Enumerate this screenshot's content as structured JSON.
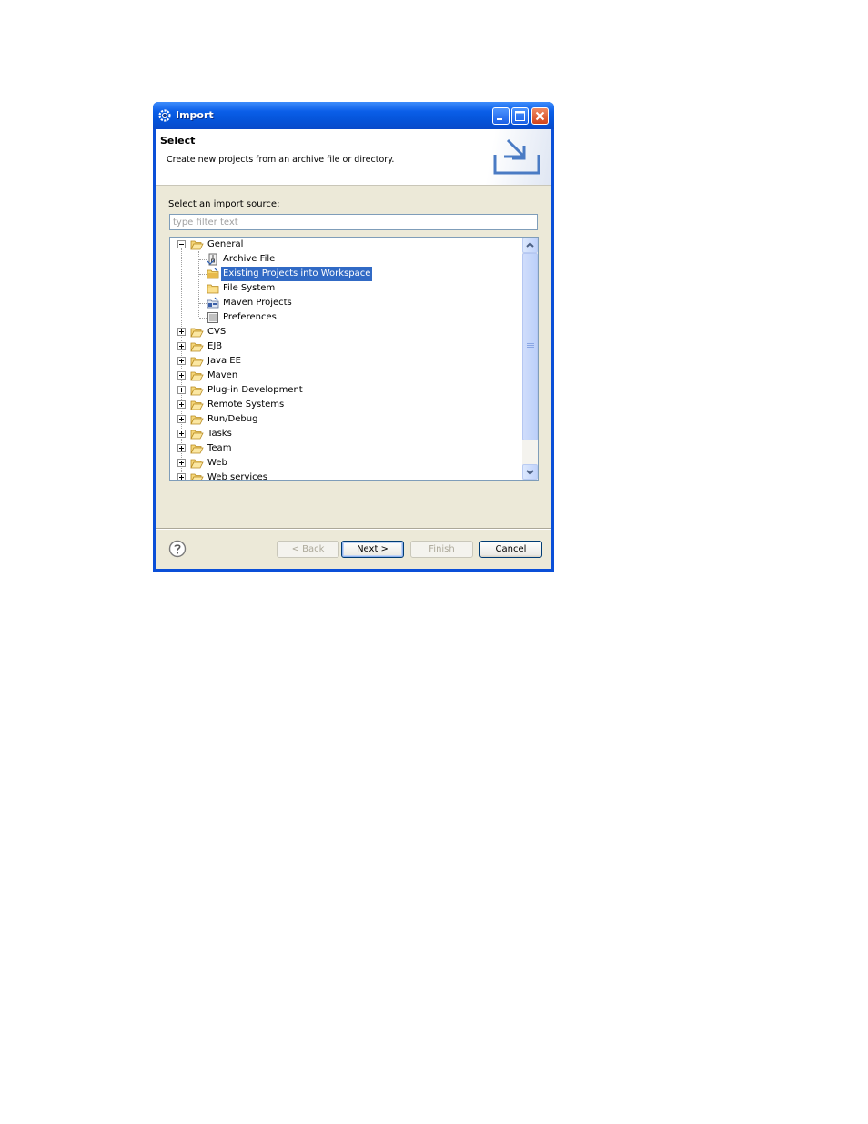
{
  "window": {
    "title": "Import",
    "icons": {
      "app": "eclipse-gear-icon",
      "minimize": "minimize-icon",
      "maximize": "maximize-icon",
      "close": "close-icon"
    }
  },
  "header": {
    "title": "Select",
    "description": "Create new projects from an archive file or directory.",
    "graphic": "import-wizard-icon"
  },
  "source": {
    "label": "Select an import source:",
    "filter_placeholder": "type filter text",
    "filter_value": ""
  },
  "tree": {
    "general": {
      "label": "General",
      "expanded": true,
      "children": [
        {
          "label": "Archive File",
          "icon": "archive-file-icon"
        },
        {
          "label": "Existing Projects into Workspace",
          "icon": "existing-projects-icon",
          "selected": true
        },
        {
          "label": "File System",
          "icon": "folder-icon"
        },
        {
          "label": "Maven Projects",
          "icon": "maven-projects-icon"
        },
        {
          "label": "Preferences",
          "icon": "preferences-icon"
        }
      ]
    },
    "categories": [
      "CVS",
      "EJB",
      "Java EE",
      "Maven",
      "Plug-in Development",
      "Remote Systems",
      "Run/Debug",
      "Tasks",
      "Team",
      "Web",
      "Web services"
    ]
  },
  "buttons": {
    "help_icon": "help-icon",
    "back": "< Back",
    "next": "Next >",
    "finish": "Finish",
    "cancel": "Cancel"
  },
  "colors": {
    "title_bar": "#0a5ee8",
    "selection": "#316ac5",
    "dialog_bg": "#ece9d8"
  }
}
